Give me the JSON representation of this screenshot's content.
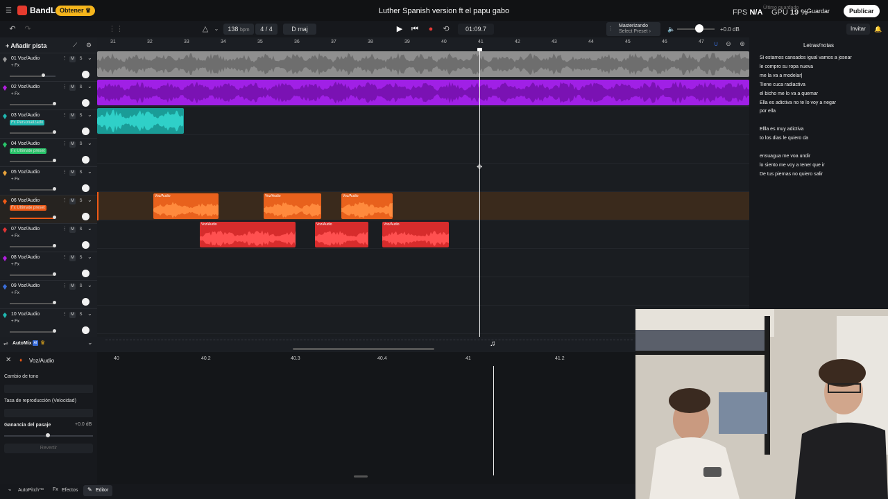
{
  "app": {
    "brand": "BandLab",
    "cta": "Obtener ♛",
    "project_title": "Luther Spanish version ft el papu gabo",
    "fps_label": "FPS",
    "fps_value": "N/A",
    "gpu_label": "GPU",
    "gpu_value": "19 %",
    "gpu_sub": "Último guardado",
    "share": "Guardar",
    "publish": "Publicar"
  },
  "transport": {
    "bpm": "138",
    "bpm_unit": "bpm",
    "time_sig": "4 / 4",
    "key": "D maj",
    "time": "01:09.7",
    "master_title": "Masterizando",
    "master_preset": "Select Preset ›",
    "volume_db": "+0.0 dB",
    "invite": "Invitar"
  },
  "tracks_panel": {
    "add_track": "+ Añadir pista",
    "tracks": [
      {
        "name": "01 Voz/Audio",
        "fx": "+ Fx",
        "color": "#9a9a9a"
      },
      {
        "name": "02 Voz/Audio",
        "fx": "+ Fx",
        "color": "#b21fe0"
      },
      {
        "name": "03 Voz/Audio",
        "fx": "Fx Personalizado",
        "color": "#1fb8b0"
      },
      {
        "name": "04 Voz/Audio",
        "fx": "Fx Ultimate preset",
        "color": "#29c46a"
      },
      {
        "name": "05 Voz/Audio",
        "fx": "+ Fx",
        "color": "#e8a33b"
      },
      {
        "name": "06 Voz/Audio",
        "fx": "Fx Ultimate preset",
        "color": "#f05a16"
      },
      {
        "name": "07 Voz/Audio",
        "fx": "+ Fx",
        "color": "#e03434"
      },
      {
        "name": "08 Voz/Audio",
        "fx": "+ Fx",
        "color": "#b21fe0"
      },
      {
        "name": "09 Voz/Audio",
        "fx": "+ Fx",
        "color": "#3a6edb"
      },
      {
        "name": "10 Voz/Audio",
        "fx": "+ Fx",
        "color": "#1fb8b0"
      }
    ],
    "mute": "M",
    "solo": "S"
  },
  "ruler": {
    "bars": [
      "31",
      "32",
      "33",
      "34",
      "35",
      "36",
      "37",
      "38",
      "39",
      "40",
      "41",
      "42",
      "43",
      "44",
      "45",
      "46",
      "47"
    ]
  },
  "clips": {
    "label": "Voz/Audio"
  },
  "colors": {
    "gray": "#8f8f8f",
    "purple": "#a020e6",
    "teal": "#1a9c97",
    "orange": "#e8611c",
    "red": "#d72c2c",
    "cta": "#f5b51c"
  },
  "lyrics": {
    "title": "Letras/notas",
    "lines": [
      "Si estamos cansados igual vamos a josear",
      "le compro su ropa nueva",
      "me la va a modelar|",
      "Tiene cuca radiactiva",
      "el bicho me lo va a quemar",
      "Ella es adictiva no te lo voy a negar",
      "por ella",
      "",
      "Ellla es muy adictiva",
      "to los dias le quiero da",
      "",
      "ensuagua me voa undir",
      "lo siento me voy a tener que ir",
      "De tus piernas no quiero salir"
    ]
  },
  "automix": {
    "label": "AutoMix",
    "ai": "AI"
  },
  "editor": {
    "track": "Voz/Audio",
    "pitch_label": "Cambio de tono",
    "speed_label": "Tasa de reproducción (Velocidad)",
    "gain_label": "Ganancia del pasaje",
    "gain_value": "+0.0 dB",
    "revert": "Revertir",
    "ticks": [
      "40",
      "40.2",
      "40.3",
      "40.4",
      "41",
      "41.2"
    ]
  },
  "bottom_tabs": {
    "autopitch": "AutoPitch™",
    "effects": "Efectos",
    "editor": "Editor"
  }
}
